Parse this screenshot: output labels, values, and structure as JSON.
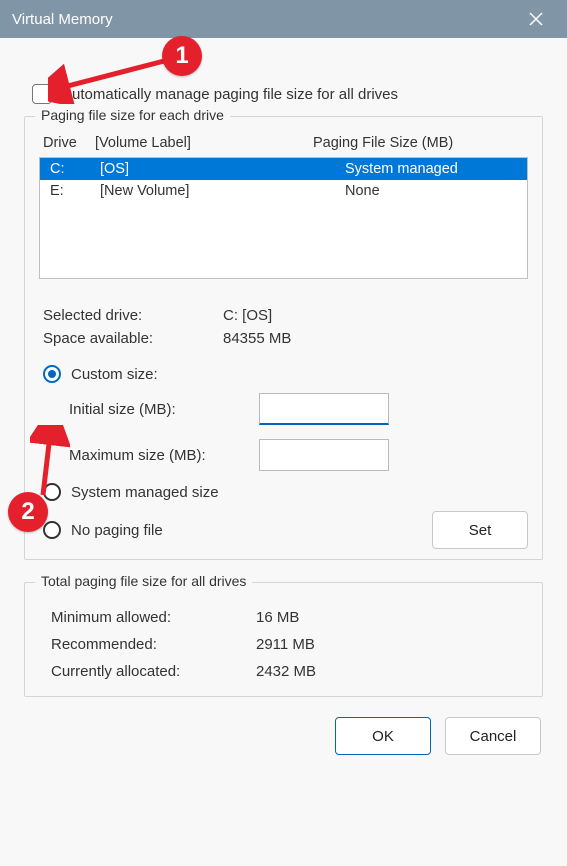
{
  "title": "Virtual Memory",
  "auto_manage_label": "Automatically manage paging file size for all drives",
  "group_drives_title": "Paging file size for each drive",
  "headers": {
    "drive": "Drive",
    "volume": "[Volume Label]",
    "pfsize": "Paging File Size (MB)"
  },
  "drives": [
    {
      "letter": "C:",
      "volume": "[OS]",
      "paging": "System managed",
      "selected": true
    },
    {
      "letter": "E:",
      "volume": "[New Volume]",
      "paging": "None",
      "selected": false
    }
  ],
  "selected_drive_label": "Selected drive:",
  "selected_drive_value": "C:  [OS]",
  "space_available_label": "Space available:",
  "space_available_value": "84355 MB",
  "radio_custom": "Custom size:",
  "initial_label": "Initial size (MB):",
  "initial_value": "",
  "maximum_label": "Maximum size (MB):",
  "maximum_value": "",
  "radio_system": "System managed size",
  "radio_none": "No paging file",
  "set_button": "Set",
  "group_totals_title": "Total paging file size for all drives",
  "min_allowed_label": "Minimum allowed:",
  "min_allowed_value": "16 MB",
  "recommended_label": "Recommended:",
  "recommended_value": "2911 MB",
  "current_label": "Currently allocated:",
  "current_value": "2432 MB",
  "ok_button": "OK",
  "cancel_button": "Cancel",
  "annotations": {
    "badge1": "1",
    "badge2": "2"
  }
}
